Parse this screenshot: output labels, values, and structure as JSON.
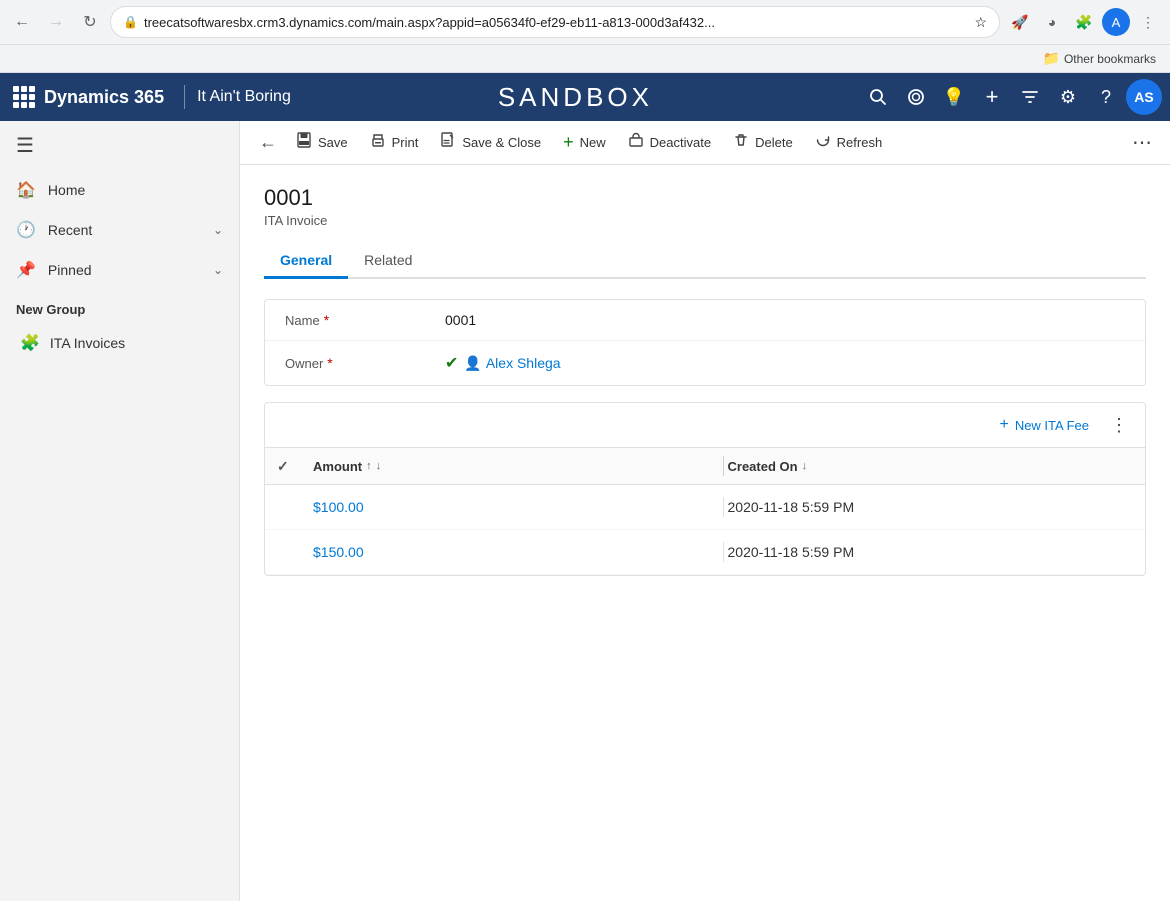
{
  "browser": {
    "back_disabled": false,
    "forward_disabled": true,
    "url": "treecatsoftwaresbx.crm3.dynamics.com/main.aspx?appid=a05634f0-ef29-eb11-a813-000d3af432...",
    "bookmarks_label": "Other bookmarks",
    "avatar_initials": "A"
  },
  "topnav": {
    "brand": "Dynamics 365",
    "app_name": "It Ain't Boring",
    "sandbox_title": "SANDBOX",
    "avatar_initials": "AS",
    "actions": {
      "search": "🔍",
      "goal": "◎",
      "idea": "💡",
      "add": "+",
      "filter": "⊿",
      "settings": "⚙",
      "help": "?"
    }
  },
  "sidebar": {
    "home_label": "Home",
    "recent_label": "Recent",
    "pinned_label": "Pinned",
    "new_group_label": "New Group",
    "menu_items": [
      {
        "label": "ITA Invoices",
        "icon": "puzzle"
      }
    ]
  },
  "commandbar": {
    "save_label": "Save",
    "print_label": "Print",
    "save_close_label": "Save & Close",
    "new_label": "New",
    "deactivate_label": "Deactivate",
    "delete_label": "Delete",
    "refresh_label": "Refresh"
  },
  "record": {
    "title": "0001",
    "subtitle": "ITA Invoice"
  },
  "tabs": [
    {
      "label": "General",
      "active": true
    },
    {
      "label": "Related",
      "active": false
    }
  ],
  "form": {
    "name_label": "Name",
    "name_value": "0001",
    "owner_label": "Owner",
    "owner_name": "Alex Shlega"
  },
  "subgrid": {
    "new_fee_label": "New ITA Fee",
    "amount_col": "Amount",
    "created_col": "Created On",
    "rows": [
      {
        "amount": "$100.00",
        "created": "2020-11-18 5:59 PM"
      },
      {
        "amount": "$150.00",
        "created": "2020-11-18 5:59 PM"
      }
    ]
  }
}
